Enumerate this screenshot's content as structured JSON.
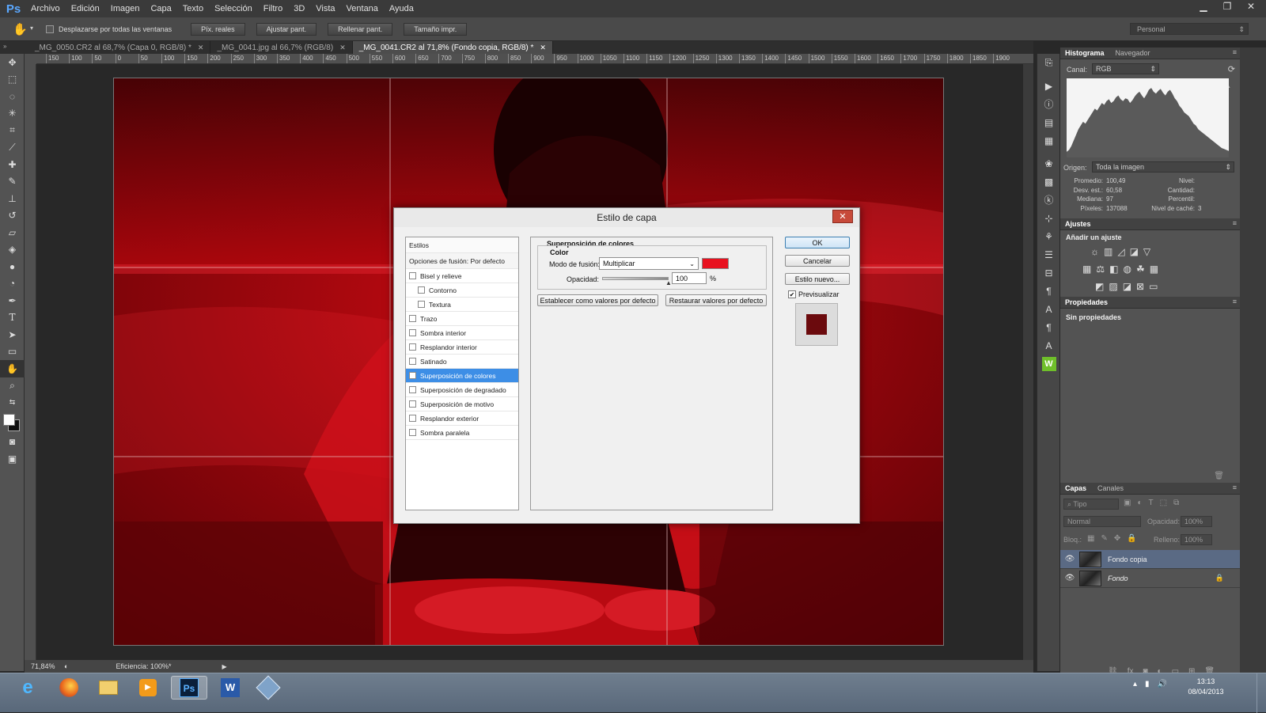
{
  "app": {
    "logo": "Ps",
    "date": "08/04/2013",
    "time": "13:13"
  },
  "menu": [
    "Archivo",
    "Edición",
    "Imagen",
    "Capa",
    "Texto",
    "Selección",
    "Filtro",
    "3D",
    "Vista",
    "Ventana",
    "Ayuda"
  ],
  "options": {
    "scroll_all": "Desplazarse por todas las ventanas",
    "buttons": [
      "Píx. reales",
      "Ajustar pant.",
      "Rellenar pant.",
      "Tamaño impr."
    ],
    "workspace": "Personal"
  },
  "tabs": [
    {
      "label": "_MG_0050.CR2 al 68,7% (Capa 0, RGB/8) *",
      "active": false
    },
    {
      "label": "_MG_0041.jpg al 66,7% (RGB/8)",
      "active": false
    },
    {
      "label": "_MG_0041.CR2 al 71,8% (Fondo copia, RGB/8) *",
      "active": true
    }
  ],
  "ruler_ticks": [
    "150",
    "100",
    "50",
    "0",
    "50",
    "100",
    "150",
    "200",
    "250",
    "300",
    "350",
    "400",
    "450",
    "500",
    "550",
    "600",
    "650",
    "700",
    "750",
    "800",
    "850",
    "900",
    "950",
    "1000",
    "1050",
    "1100",
    "1150",
    "1200",
    "1250",
    "1300",
    "1350",
    "1400",
    "1450",
    "1500",
    "1550",
    "1600",
    "1650",
    "1700",
    "1750",
    "1800",
    "1850",
    "1900"
  ],
  "status": {
    "zoom": "71,84%",
    "efficiency": "Eficiencia: 100%*"
  },
  "histogram": {
    "tabs": [
      "Histograma",
      "Navegador"
    ],
    "canal_label": "Canal:",
    "canal_value": "RGB",
    "origen_label": "Origen:",
    "origen_value": "Toda la imagen",
    "stats_left": [
      {
        "k": "Promedio:",
        "v": "100,49"
      },
      {
        "k": "Desv. est.:",
        "v": "60,58"
      },
      {
        "k": "Mediana:",
        "v": "97"
      },
      {
        "k": "Píxeles:",
        "v": "137088"
      }
    ],
    "stats_right": [
      {
        "k": "Nivel:",
        "v": ""
      },
      {
        "k": "Cantidad:",
        "v": ""
      },
      {
        "k": "Percentil:",
        "v": ""
      },
      {
        "k": "Nivel de caché:",
        "v": "3"
      }
    ],
    "shape": [
      6,
      8,
      12,
      18,
      24,
      30,
      34,
      38,
      36,
      40,
      44,
      48,
      52,
      50,
      54,
      58,
      56,
      60,
      62,
      58,
      60,
      64,
      66,
      62,
      60,
      63,
      62,
      58,
      61,
      65,
      68,
      70,
      66,
      63,
      67,
      72,
      74,
      70,
      68,
      71,
      73,
      69,
      66,
      70,
      72,
      68,
      63,
      60,
      55,
      52,
      48,
      46,
      44,
      40,
      36,
      34,
      30,
      28,
      26,
      24,
      22,
      20,
      18,
      16,
      14,
      12,
      10,
      9,
      8,
      7
    ]
  },
  "ajustes": {
    "title": "Ajustes",
    "add": "Añadir un ajuste"
  },
  "propiedades": {
    "title": "Propiedades",
    "none": "Sin propiedades"
  },
  "layers": {
    "tabs": [
      "Capas",
      "Canales"
    ],
    "kind": "Tipo",
    "blend": "Normal",
    "opacity_label": "Opacidad:",
    "opacity": "100%",
    "lock_label": "Bloq.:",
    "fill_label": "Relleno:",
    "fill": "100%",
    "items": [
      {
        "name": "Fondo copia",
        "selected": true,
        "locked": false
      },
      {
        "name": "Fondo",
        "selected": false,
        "locked": true
      }
    ]
  },
  "dialog": {
    "title": "Estilo de capa",
    "styles_header": "Estilos",
    "blend_options": "Opciones de fusión: Por defecto",
    "styles": [
      {
        "label": "Bisel y relieve",
        "checked": false,
        "sub": false,
        "selected": false
      },
      {
        "label": "Contorno",
        "checked": false,
        "sub": true,
        "selected": false
      },
      {
        "label": "Textura",
        "checked": false,
        "sub": true,
        "selected": false
      },
      {
        "label": "Trazo",
        "checked": false,
        "sub": false,
        "selected": false
      },
      {
        "label": "Sombra interior",
        "checked": false,
        "sub": false,
        "selected": false
      },
      {
        "label": "Resplandor interior",
        "checked": false,
        "sub": false,
        "selected": false
      },
      {
        "label": "Satinado",
        "checked": false,
        "sub": false,
        "selected": false
      },
      {
        "label": "Superposición de colores",
        "checked": true,
        "sub": false,
        "selected": true
      },
      {
        "label": "Superposición de degradado",
        "checked": false,
        "sub": false,
        "selected": false
      },
      {
        "label": "Superposición de motivo",
        "checked": false,
        "sub": false,
        "selected": false
      },
      {
        "label": "Resplandor exterior",
        "checked": false,
        "sub": false,
        "selected": false
      },
      {
        "label": "Sombra paralela",
        "checked": false,
        "sub": false,
        "selected": false
      }
    ],
    "section_title": "Superposición de colores",
    "group_title": "Color",
    "blend_mode_label": "Modo de fusión:",
    "blend_mode_value": "Multiplicar",
    "overlay_color": "#e8101e",
    "opacity_label": "Opacidad:",
    "opacity_value": "100",
    "opacity_unit": "%",
    "opacity_fraction": 1.0,
    "btn_default_set": "Establecer como valores por defecto",
    "btn_default_reset": "Restaurar valores por defecto",
    "ok": "OK",
    "cancel": "Cancelar",
    "new_style": "Estilo nuevo...",
    "preview_label": "Previsualizar",
    "preview_checked": true,
    "preview_color": "#6b0a0d"
  }
}
